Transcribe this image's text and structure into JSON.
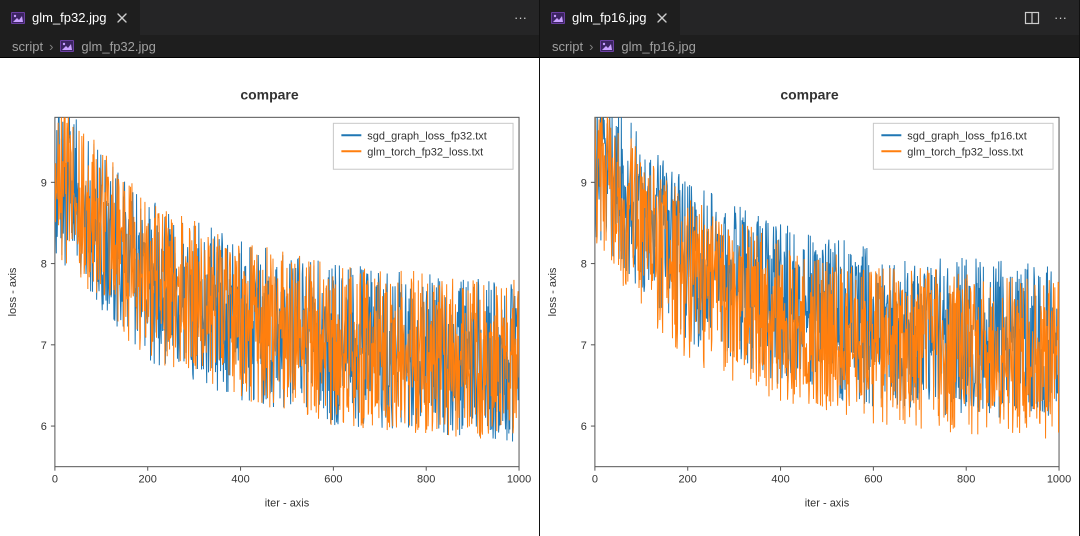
{
  "editor": {
    "panes": [
      {
        "tab": {
          "filename": "glm_fp32.jpg",
          "icon": "image-file-icon"
        },
        "actions": {
          "more": "···"
        },
        "breadcrumb": {
          "folder": "script",
          "file": "glm_fp32.jpg"
        }
      },
      {
        "tab": {
          "filename": "glm_fp16.jpg",
          "icon": "image-file-icon"
        },
        "actions": {
          "split": "split-editor-icon",
          "more": "···"
        },
        "breadcrumb": {
          "folder": "script",
          "file": "glm_fp16.jpg"
        }
      }
    ]
  },
  "colors": {
    "series_a": "#1f77b4",
    "series_b": "#ff7f0e",
    "grid": "#e9e9e9"
  },
  "chart_data": [
    {
      "type": "line",
      "title": "compare",
      "xlabel": "iter - axis",
      "ylabel": "loss - axis",
      "xlim": [
        0,
        1000
      ],
      "ylim": [
        5.5,
        9.8
      ],
      "xticks": [
        0,
        200,
        400,
        600,
        800,
        1000
      ],
      "yticks": [
        6,
        7,
        8,
        9
      ],
      "legend": [
        "sgd_graph_loss_fp32.txt",
        "glm_torch_fp32_loss.txt"
      ],
      "series": [
        {
          "name": "sgd_graph_loss_fp32.txt",
          "color_key": "series_a",
          "trend": {
            "x": [
              0,
              50,
              100,
              200,
              400,
              600,
              800,
              1000
            ],
            "y": [
              9.1,
              8.8,
              8.4,
              7.8,
              7.3,
              7.0,
              6.9,
              6.8
            ]
          },
          "noise_amp": 1.0
        },
        {
          "name": "glm_torch_fp32_loss.txt",
          "color_key": "series_b",
          "trend": {
            "x": [
              0,
              50,
              100,
              200,
              400,
              600,
              800,
              1000
            ],
            "y": [
              9.1,
              8.8,
              8.4,
              7.8,
              7.3,
              7.0,
              6.9,
              6.8
            ]
          },
          "noise_amp": 1.0
        }
      ]
    },
    {
      "type": "line",
      "title": "compare",
      "xlabel": "iter - axis",
      "ylabel": "loss - axis",
      "xlim": [
        0,
        1000
      ],
      "ylim": [
        5.5,
        9.8
      ],
      "xticks": [
        0,
        200,
        400,
        600,
        800,
        1000
      ],
      "yticks": [
        6,
        7,
        8,
        9
      ],
      "legend": [
        "sgd_graph_loss_fp16.txt",
        "glm_torch_fp32_loss.txt"
      ],
      "series": [
        {
          "name": "sgd_graph_loss_fp16.txt",
          "color_key": "series_a",
          "trend": {
            "x": [
              0,
              50,
              100,
              200,
              400,
              600,
              800,
              1000
            ],
            "y": [
              9.3,
              9.0,
              8.6,
              8.0,
              7.5,
              7.2,
              7.1,
              7.0
            ]
          },
          "noise_amp": 1.0
        },
        {
          "name": "glm_torch_fp32_loss.txt",
          "color_key": "series_b",
          "trend": {
            "x": [
              0,
              50,
              100,
              200,
              400,
              600,
              800,
              1000
            ],
            "y": [
              9.1,
              8.8,
              8.4,
              7.8,
              7.3,
              7.0,
              6.9,
              6.8
            ]
          },
          "noise_amp": 1.0
        }
      ]
    }
  ]
}
